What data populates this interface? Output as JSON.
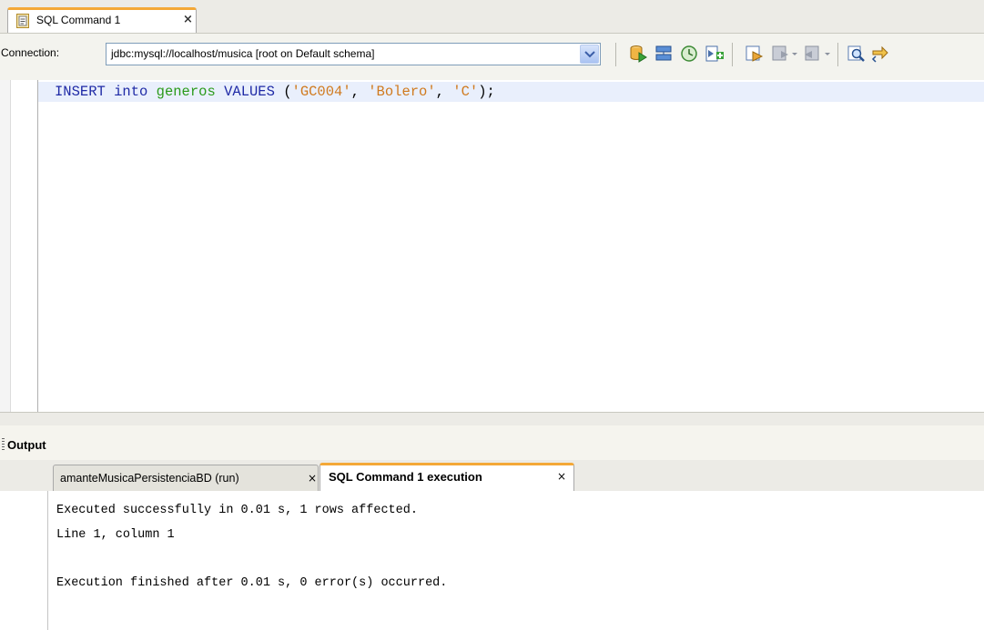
{
  "editor_tab": {
    "label": "SQL Command 1",
    "close": "×"
  },
  "toolbar": {
    "connection_label": "Connection:",
    "connection_value": "jdbc:mysql://localhost/musica [root on Default schema]",
    "icons": [
      "run-sql-icon",
      "execute-icon",
      "history-icon",
      "add-icon",
      "bookmark-icon",
      "prev-bookmark-icon",
      "next-bookmark-icon",
      "find-icon",
      "replace-icon"
    ]
  },
  "code": {
    "kw1": "INSERT",
    "kw2": "into",
    "table": "generos",
    "kw3": "VALUES",
    "open": " (",
    "v1": "'GC004'",
    "sep1": ", ",
    "v2": "'Bolero'",
    "sep2": ", ",
    "v3": "'C'",
    "close": ");"
  },
  "output": {
    "title": "Output",
    "tabs": [
      {
        "label": "amanteMusicaPersistenciaBD (run)",
        "close": "×"
      },
      {
        "label": "SQL Command 1 execution",
        "close": "×"
      }
    ],
    "lines": [
      "Executed successfully in 0.01 s, 1 rows affected.",
      "Line 1, column 1",
      "",
      "Execution finished after 0.01 s, 0 error(s) occurred."
    ]
  },
  "colors": {
    "accent_tab": "#f4a837",
    "keyword": "#1f2aa6",
    "identifier": "#2a9a1a",
    "string": "#d07a1e",
    "current_line": "#e9effc"
  }
}
